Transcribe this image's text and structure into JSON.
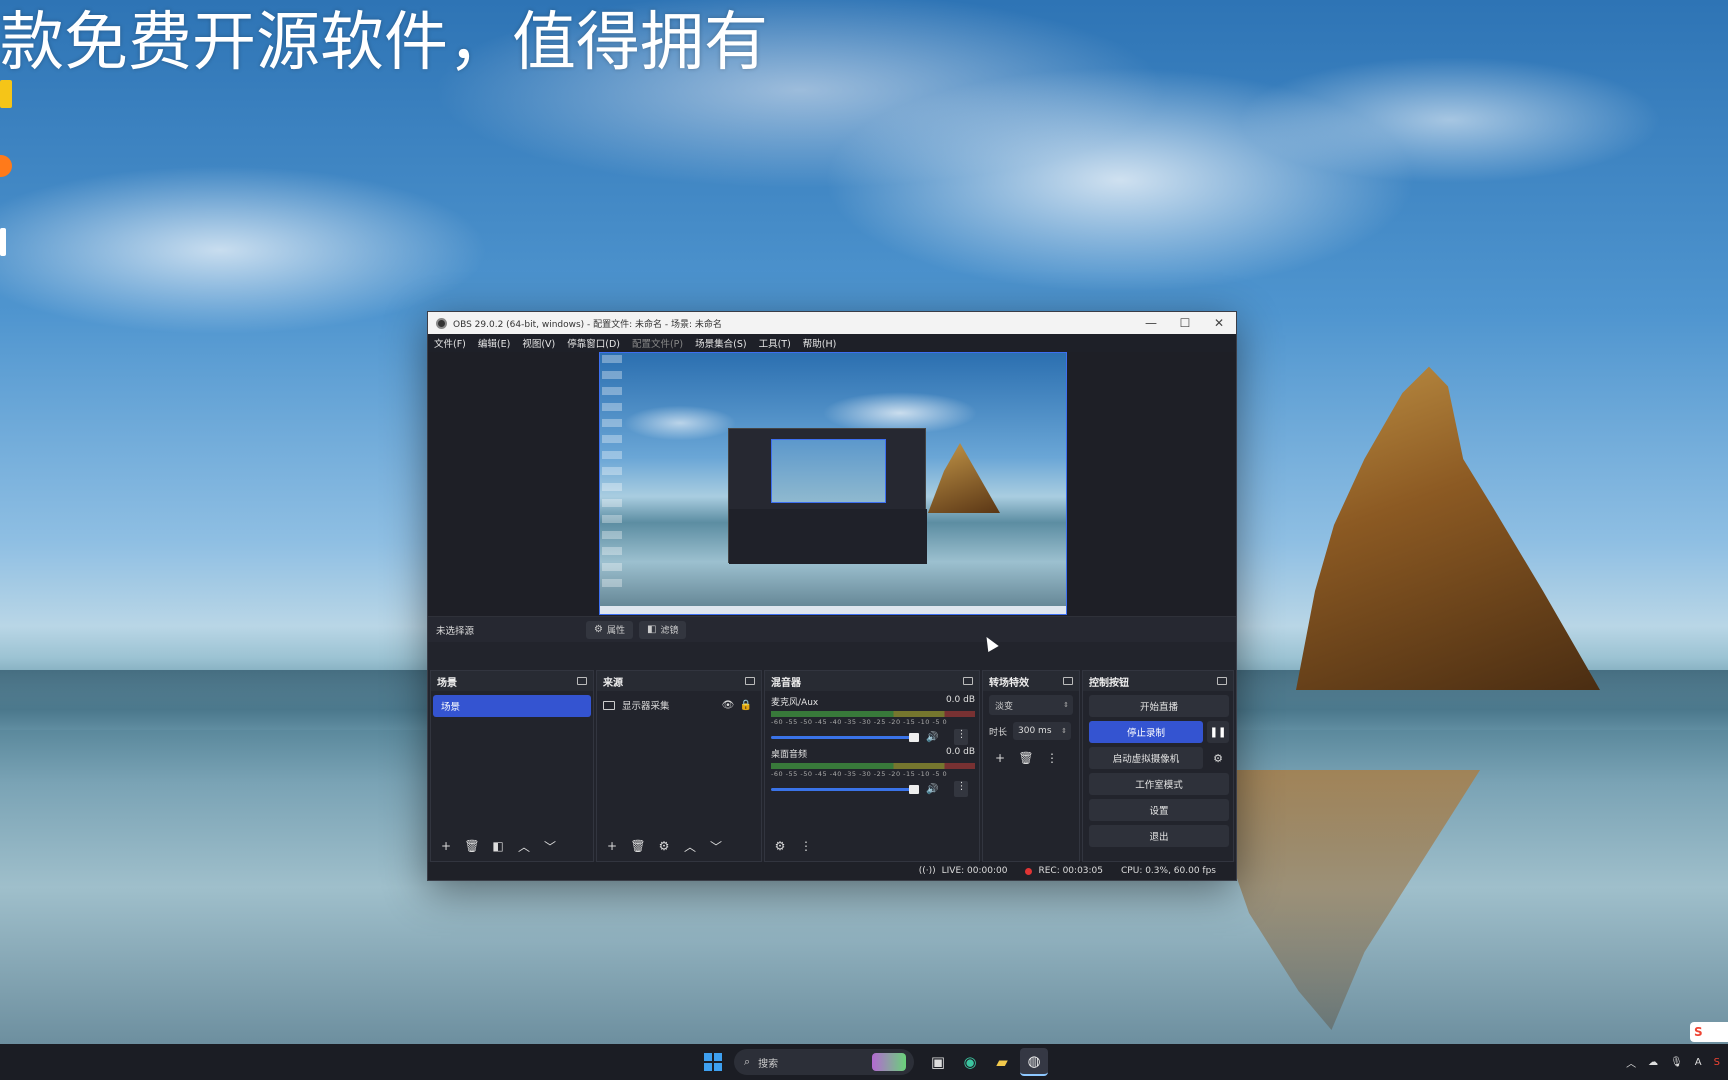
{
  "overlay_title": "款免费开源软件，值得拥有",
  "obs": {
    "title": "OBS 29.0.2 (64-bit, windows) - 配置文件: 未命名 - 场景: 未命名",
    "window_controls": {
      "minimize": "—",
      "maximize": "☐",
      "close": "✕"
    },
    "menu": [
      "文件(F)",
      "编辑(E)",
      "视图(V)",
      "停靠窗口(D)",
      "配置文件(P)",
      "场景集合(S)",
      "工具(T)",
      "帮助(H)"
    ],
    "source_bar": {
      "no_selection": "未选择源",
      "properties": "属性",
      "filters": "滤镜"
    },
    "scenes": {
      "title": "场景",
      "items": [
        "场景"
      ]
    },
    "sources": {
      "title": "来源",
      "items": [
        {
          "label": "显示器采集",
          "icon": "monitor-icon",
          "visible": true,
          "locked": false
        }
      ]
    },
    "mixer": {
      "title": "混音器",
      "ticks": "-60 -55 -50 -45 -40 -35 -30 -25 -20 -15 -10 -5 0",
      "channels": [
        {
          "name": "麦克风/Aux",
          "db": "0.0 dB",
          "volume": 1.0
        },
        {
          "name": "桌面音频",
          "db": "0.0 dB",
          "volume": 1.0
        }
      ]
    },
    "transitions": {
      "title": "转场特效",
      "selected": "淡变",
      "duration_label": "时长",
      "duration_value": "300 ms"
    },
    "controls": {
      "title": "控制按钮",
      "start_stream": "开始直播",
      "stop_record": "停止录制",
      "start_virtual_cam": "启动虚拟摄像机",
      "studio_mode": "工作室模式",
      "settings": "设置",
      "exit": "退出"
    },
    "status": {
      "live": "LIVE: 00:00:00",
      "rec": "REC: 00:03:05",
      "cpu": "CPU: 0.3%, 60.00 fps"
    }
  },
  "taskbar": {
    "search_placeholder": "搜索",
    "tray_lang": "A"
  },
  "colors": {
    "accent": "#3454d1",
    "rec": "#e03434"
  }
}
